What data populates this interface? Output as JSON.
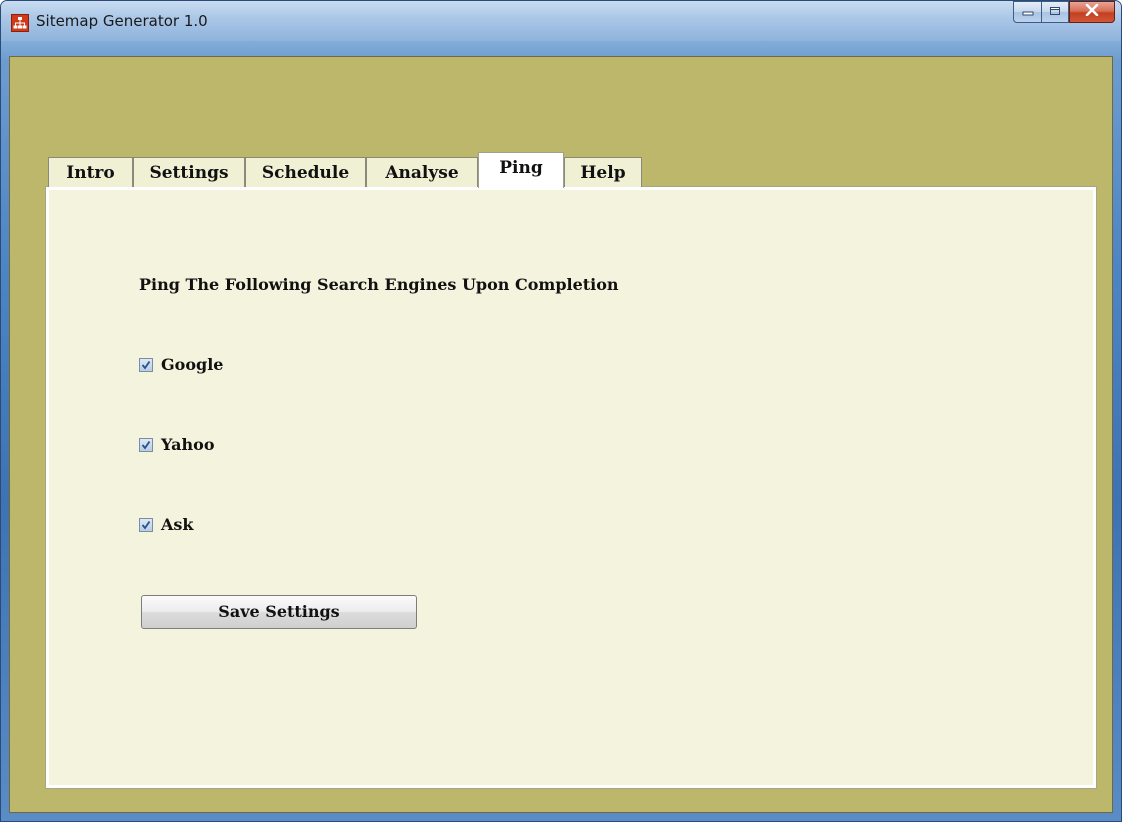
{
  "window": {
    "title": "Sitemap Generator 1.0",
    "controls": {
      "minimize_icon": "minimize-icon",
      "maximize_icon": "maximize-icon",
      "close_icon": "close-icon"
    }
  },
  "tabs": [
    {
      "label": "Intro",
      "active": false
    },
    {
      "label": "Settings",
      "active": false
    },
    {
      "label": "Schedule",
      "active": false
    },
    {
      "label": "Analyse",
      "active": false
    },
    {
      "label": "Ping",
      "active": true
    },
    {
      "label": "Help",
      "active": false
    }
  ],
  "ping": {
    "heading": "Ping The Following Search Engines Upon Completion",
    "engines": [
      {
        "label": "Google",
        "checked": true
      },
      {
        "label": "Yahoo",
        "checked": true
      },
      {
        "label": "Ask",
        "checked": true
      }
    ],
    "save_label": "Save Settings"
  },
  "colors": {
    "client_background": "#bdb76c",
    "panel_background": "#f3f3de",
    "active_tab": "#ffffff"
  }
}
